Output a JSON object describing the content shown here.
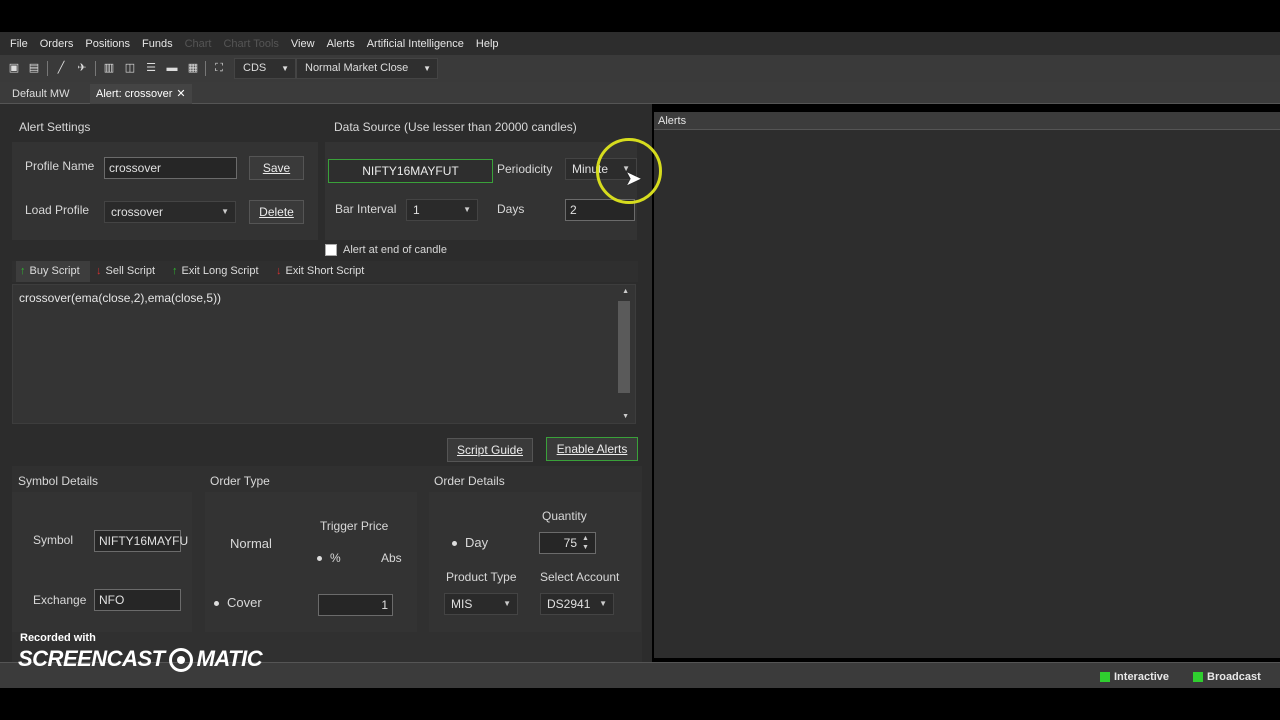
{
  "menu": {
    "items": [
      "File",
      "Orders",
      "Positions",
      "Funds"
    ],
    "dim_items": [
      "Chart",
      "Chart Tools"
    ],
    "items2": [
      "View",
      "Alerts",
      "Artificial Intelligence",
      "Help"
    ]
  },
  "toolbar": {
    "exchange_select": "CDS",
    "market_select": "Normal Market Close"
  },
  "tabs": {
    "tab1": "Default MW",
    "tab2": "Alert: crossover",
    "close": "✕"
  },
  "alert_settings": {
    "title": "Alert Settings",
    "profile_name_label": "Profile Name",
    "profile_name_value": "crossover",
    "save_label": "Save",
    "load_profile_label": "Load Profile",
    "load_profile_value": "crossover",
    "delete_label": "Delete"
  },
  "data_source": {
    "title": "Data Source (Use lesser than 20000 candles)",
    "symbol_button": "NIFTY16MAYFUT",
    "periodicity_label": "Periodicity",
    "periodicity_value": "Minute",
    "bar_interval_label": "Bar Interval",
    "bar_interval_value": "1",
    "days_label": "Days",
    "days_value": "2",
    "end_of_candle_label": "Alert at end of candle"
  },
  "script_tabs": {
    "buy": "Buy Script",
    "sell": "Sell Script",
    "exit_long": "Exit Long Script",
    "exit_short": "Exit Short Script"
  },
  "editor": {
    "content": "crossover(ema(close,2),ema(close,5))"
  },
  "actions": {
    "script_guide": "Script Guide",
    "enable_alerts": "Enable Alerts"
  },
  "symbol_details": {
    "title": "Symbol Details",
    "symbol_label": "Symbol",
    "symbol_value": "NIFTY16MAYFU",
    "exchange_label": "Exchange",
    "exchange_value": "NFO"
  },
  "order_type": {
    "title": "Order Type",
    "normal": "Normal",
    "trigger_price_label": "Trigger Price",
    "percent": "%",
    "abs": "Abs",
    "cover": "Cover",
    "trigger_value": "1"
  },
  "order_details": {
    "title": "Order Details",
    "day": "Day",
    "quantity_label": "Quantity",
    "quantity_value": "75",
    "product_type_label": "Product Type",
    "product_type_value": "MIS",
    "select_account_label": "Select Account",
    "select_account_value": "DS2941"
  },
  "alerts_panel": {
    "title": "Alerts"
  },
  "status": {
    "interactive": "Interactive",
    "broadcast": "Broadcast"
  },
  "watermark": {
    "recorded_with": "Recorded with",
    "brand_left": "SCREENCAST",
    "brand_right": "MATIC"
  }
}
